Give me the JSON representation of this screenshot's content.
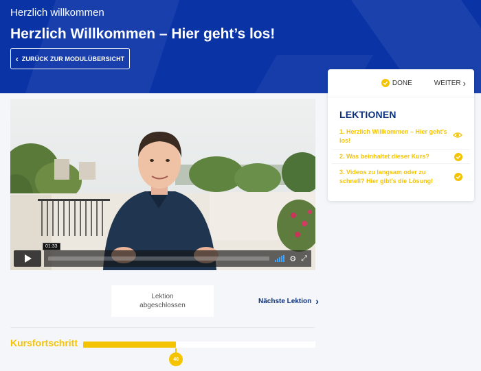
{
  "header": {
    "breadcrumb": "Herzlich willkommen",
    "title": "Herzlich Willkommen – Hier geht’s los!",
    "back_label": "ZURÜCK ZUR MODULÜBERSICHT"
  },
  "video": {
    "time_tooltip": "01:33",
    "play_icon": "play-icon",
    "settings_icon": "gear-icon",
    "fullscreen_icon": "fullscreen-icon"
  },
  "lesson_controls": {
    "complete_line1": "Lektion",
    "complete_line2": "abgeschlossen",
    "next_label": "Nächste Lektion"
  },
  "progress": {
    "label": "Kursfortschritt",
    "percent": 40,
    "percent_text": "40"
  },
  "sidebar": {
    "done_label": "DONE",
    "next_label": "WEITER",
    "heading": "LEKTIONEN",
    "lessons": [
      {
        "label": "1. Herzlich Willkommen – Hier geht’s los!",
        "status": "viewing"
      },
      {
        "label": "2. Was beinhaltet dieser Kurs?",
        "status": "done"
      },
      {
        "label": "3. Videos zu langsam oder zu schnell? Hier gibt’s die Lösung!",
        "status": "done"
      }
    ]
  },
  "colors": {
    "brand_blue": "#0a33a6",
    "accent_yellow": "#f5c400",
    "heading_navy": "#0a2f7a"
  }
}
